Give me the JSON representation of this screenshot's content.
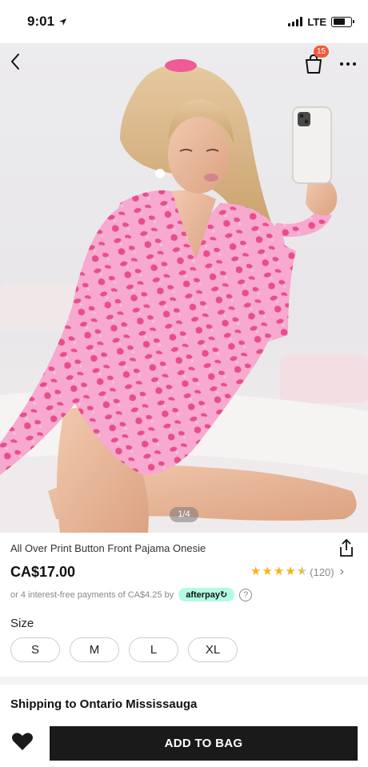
{
  "status_bar": {
    "time": "9:01",
    "network": "LTE",
    "battery_level": 0.7
  },
  "nav": {
    "back_icon": "chevron-left-icon",
    "bag_icon": "shopping-bag-icon",
    "bag_count": "15",
    "more_icon": "ellipsis-icon"
  },
  "gallery": {
    "page_indicator": "1/4",
    "current_page": 1,
    "total_pages": 4
  },
  "product": {
    "title": "All Over Print Button Front Pajama Onesie",
    "price": "CA$17.00",
    "rating": 4.5,
    "rating_count": "(120)",
    "installments_text": "or 4 interest-free payments of CA$4.25 by",
    "afterpay_label": "afterpay",
    "help_label": "?"
  },
  "size": {
    "label": "Size",
    "options": [
      "S",
      "M",
      "L",
      "XL"
    ]
  },
  "shipping": {
    "title": "Shipping to Ontario Mississauga"
  },
  "actions": {
    "add_to_bag": "ADD TO BAG"
  },
  "colors": {
    "accent_badge": "#f15a3a",
    "star": "#f6b41b",
    "afterpay_bg": "#b2fce4",
    "button_dark": "#1a1a1a",
    "print_pink": "#f7a9cf",
    "print_spots": "#e84d8a"
  }
}
